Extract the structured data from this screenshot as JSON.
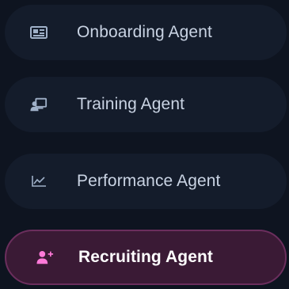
{
  "colors": {
    "background": "#0e1420",
    "item_background": "#141c2b",
    "active_background": "#3a1a35",
    "active_border": "#6b2e5d",
    "text": "#c9d3e3",
    "active_text": "#ffffff",
    "icon": "#9fb0c8",
    "active_icon": "#ff7ad9"
  },
  "agents": [
    {
      "label": "Onboarding Agent",
      "icon": "id-card-icon",
      "active": false
    },
    {
      "label": "Training Agent",
      "icon": "presentation-icon",
      "active": false
    },
    {
      "label": "Performance Agent",
      "icon": "line-chart-icon",
      "active": false
    },
    {
      "label": "Recruiting Agent",
      "icon": "add-user-icon",
      "active": true
    }
  ]
}
